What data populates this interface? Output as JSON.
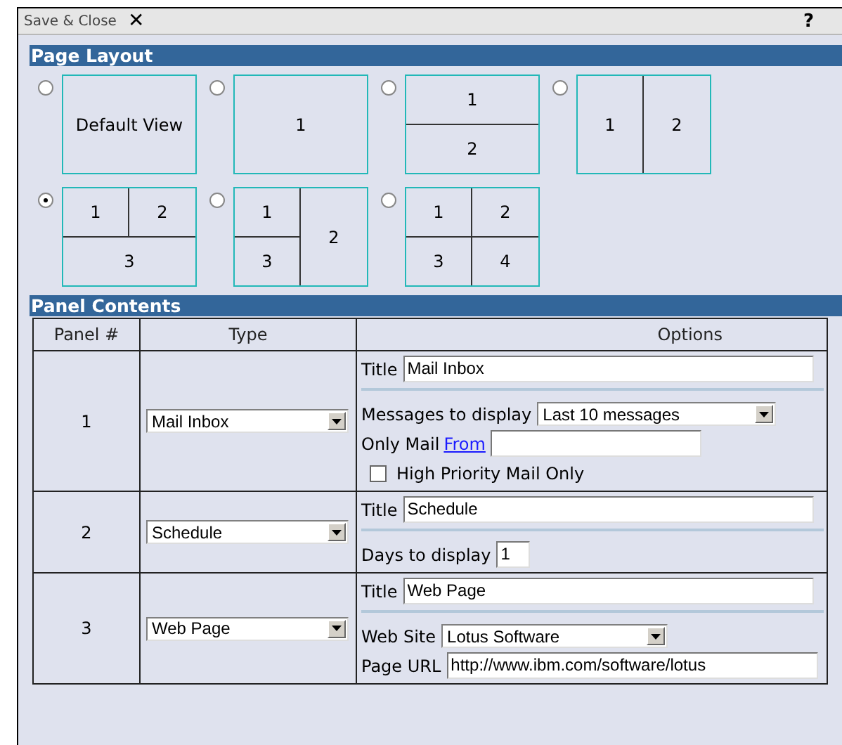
{
  "toolbar": {
    "save_close": "Save & Close",
    "close_icon": "✕",
    "help": "?"
  },
  "page_layout": {
    "heading": "Page Layout",
    "layouts": [
      {
        "kind": "single",
        "selected": false,
        "cells": [
          "Default View"
        ]
      },
      {
        "kind": "single",
        "selected": false,
        "cells": [
          "1"
        ]
      },
      {
        "kind": "rows2",
        "selected": false,
        "cells": [
          "1",
          "2"
        ]
      },
      {
        "kind": "cols2",
        "selected": false,
        "cells": [
          "1",
          "2"
        ]
      },
      {
        "kind": "two-over-one",
        "selected": true,
        "cells": [
          "1",
          "2",
          "3"
        ]
      },
      {
        "kind": "two-left-one-right",
        "selected": false,
        "cells": [
          "1",
          "3",
          "2"
        ]
      },
      {
        "kind": "grid4",
        "selected": false,
        "cells": [
          "1",
          "2",
          "3",
          "4"
        ]
      }
    ]
  },
  "panel_contents": {
    "heading": "Panel Contents",
    "columns": [
      "Panel #",
      "Type",
      "Options"
    ],
    "rows": [
      {
        "panel": "1",
        "type": "Mail Inbox",
        "title_label": "Title",
        "title": "Mail Inbox",
        "options": [
          {
            "kind": "select",
            "label": "Messages to display",
            "value": "Last 10 messages"
          },
          {
            "kind": "link-text",
            "label": "Only Mail",
            "link": "From"
          },
          {
            "kind": "checkbox",
            "label": "High Priority Mail Only",
            "checked": false
          }
        ]
      },
      {
        "panel": "2",
        "type": "Schedule",
        "title_label": "Title",
        "title": "Schedule",
        "options": [
          {
            "kind": "number",
            "label": "Days to display",
            "value": "1"
          }
        ]
      },
      {
        "panel": "3",
        "type": "Web Page",
        "title_label": "Title",
        "title": "Web Page",
        "options": [
          {
            "kind": "select",
            "label": "Web Site",
            "value": "Lotus Software"
          },
          {
            "kind": "text",
            "label": "Page URL",
            "value": "http://www.ibm.com/software/lotus"
          }
        ]
      }
    ]
  }
}
